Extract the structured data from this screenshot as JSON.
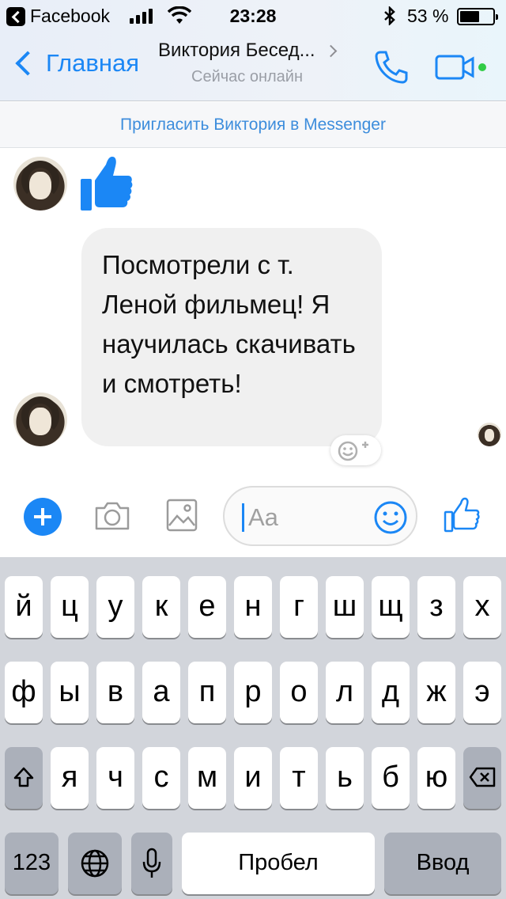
{
  "status_bar": {
    "back_app_label": "Facebook",
    "time": "23:28",
    "battery_percent": "53 %",
    "battery_level": 0.53
  },
  "nav": {
    "back_label": "Главная",
    "contact_name": "Виктория Бесед...",
    "presence": "Сейчас онлайн"
  },
  "invite_banner": "Пригласить Виктория в Messenger",
  "conversation": {
    "messages": [
      {
        "type": "like",
        "icon": "thumbs-up-icon"
      },
      {
        "type": "text",
        "text": "Посмотрели с т. Леной фильмец! Я научилась скачивать и смотреть!"
      }
    ]
  },
  "composer": {
    "placeholder": "Aa"
  },
  "keyboard": {
    "row1": [
      "й",
      "ц",
      "у",
      "к",
      "е",
      "н",
      "г",
      "ш",
      "щ",
      "з",
      "х"
    ],
    "row2": [
      "ф",
      "ы",
      "в",
      "а",
      "п",
      "р",
      "о",
      "л",
      "д",
      "ж",
      "э"
    ],
    "row3": [
      "я",
      "ч",
      "с",
      "м",
      "и",
      "т",
      "ь",
      "б",
      "ю"
    ],
    "numbers_label": "123",
    "space_label": "Пробел",
    "return_label": "Ввод"
  },
  "colors": {
    "accent": "#1b87f5",
    "bubble": "#f0f0f0",
    "keyboard_bg": "#d2d5db"
  }
}
